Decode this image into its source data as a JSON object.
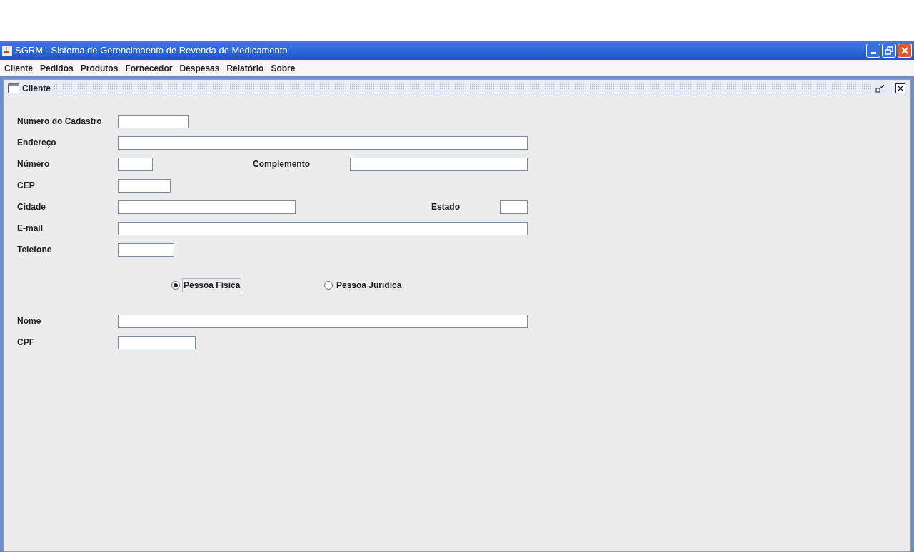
{
  "window": {
    "title": "SGRM - Sistema de Gerencimaento de Revenda de Medicamento"
  },
  "menu": [
    "Cliente",
    "Pedidos",
    "Produtos",
    "Fornecedor",
    "Despesas",
    "Relatório",
    "Sobre"
  ],
  "internal_frame": {
    "title": "Cliente"
  },
  "rows": [
    {
      "fields": [
        {
          "label": "Número do Cadastro"
        }
      ]
    },
    {
      "fields": [
        {
          "label": "Endereço"
        }
      ]
    },
    {
      "fields": [
        {
          "label": "Número"
        },
        {
          "label": "Complemento"
        }
      ]
    },
    {
      "fields": [
        {
          "label": "CEP"
        }
      ]
    },
    {
      "fields": [
        {
          "label": "Cidade"
        },
        {
          "label": "Estado"
        }
      ]
    },
    {
      "fields": [
        {
          "label": "E-mail"
        }
      ]
    },
    {
      "fields": [
        {
          "label": "Telefone"
        }
      ]
    }
  ],
  "person_type": [
    {
      "label": "Pessoa Física",
      "selected": true
    },
    {
      "label": "Pessoa Jurídica",
      "selected": false
    }
  ],
  "person_rows": [
    {
      "label": "Nome"
    },
    {
      "label": "CPF"
    }
  ]
}
